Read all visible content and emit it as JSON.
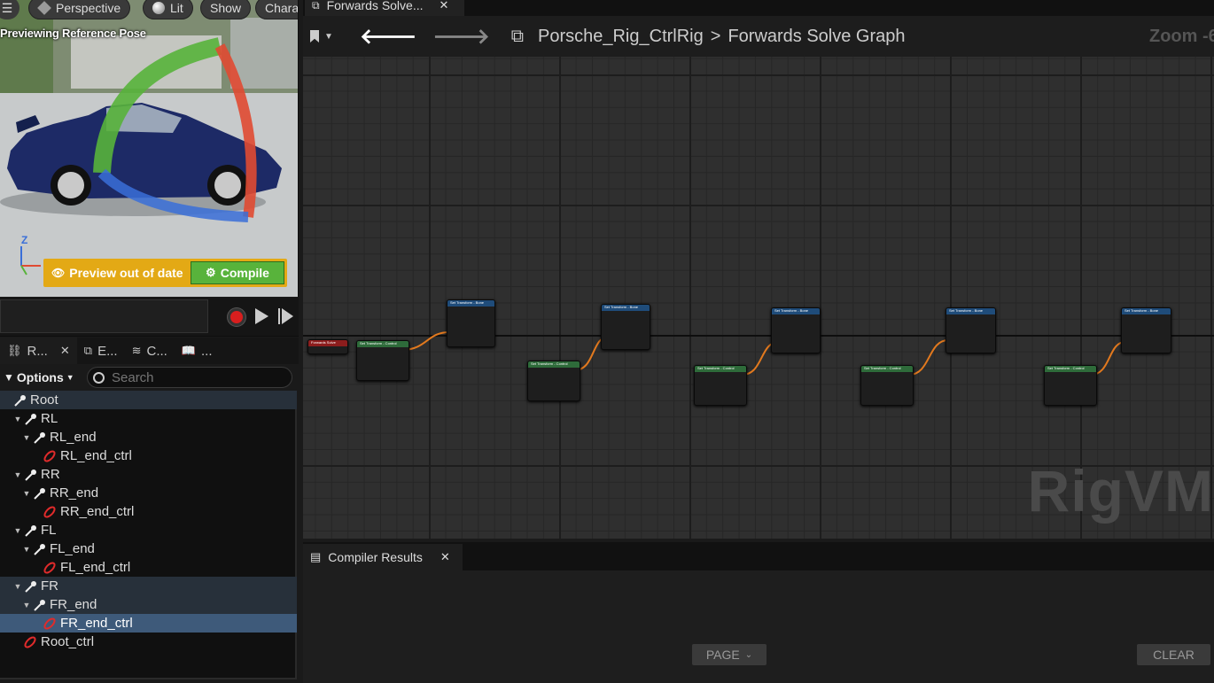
{
  "viewport": {
    "menu_icon": "hamburger-icon",
    "buttons": [
      {
        "label": "Perspective",
        "icon": "cube-icon"
      },
      {
        "label": "Lit",
        "icon": "lit-sphere-icon"
      },
      {
        "label": "Show",
        "icon": ""
      },
      {
        "label": "Chara",
        "icon": ""
      }
    ],
    "overlay_text": "Previewing Reference Pose",
    "preview_out_of_date": "Preview out of date",
    "compile": "Compile",
    "axis_label": "Z"
  },
  "transport": {
    "record_icon": "record-icon",
    "play_icon": "play-icon",
    "step_icon": "step-forward-icon"
  },
  "panel_tabs": [
    {
      "label": "R...",
      "icon": "rig-hierarchy-icon",
      "closable": true
    },
    {
      "label": "E...",
      "icon": "execution-stack-icon",
      "closable": false
    },
    {
      "label": "C...",
      "icon": "curve-container-icon",
      "closable": false
    },
    {
      "label": "...",
      "icon": "book-icon",
      "closable": false
    }
  ],
  "outliner": {
    "options": "Options",
    "search_placeholder": "Search",
    "tree": [
      {
        "label": "Root",
        "depth": 0,
        "type": "bone",
        "state": "hl"
      },
      {
        "label": "RL",
        "depth": 1,
        "type": "bone",
        "state": ""
      },
      {
        "label": "RL_end",
        "depth": 2,
        "type": "bone",
        "state": ""
      },
      {
        "label": "RL_end_ctrl",
        "depth": 3,
        "type": "control",
        "state": ""
      },
      {
        "label": "RR",
        "depth": 1,
        "type": "bone",
        "state": ""
      },
      {
        "label": "RR_end",
        "depth": 2,
        "type": "bone",
        "state": ""
      },
      {
        "label": "RR_end_ctrl",
        "depth": 3,
        "type": "control",
        "state": ""
      },
      {
        "label": "FL",
        "depth": 1,
        "type": "bone",
        "state": ""
      },
      {
        "label": "FL_end",
        "depth": 2,
        "type": "bone",
        "state": ""
      },
      {
        "label": "FL_end_ctrl",
        "depth": 3,
        "type": "control",
        "state": ""
      },
      {
        "label": "FR",
        "depth": 1,
        "type": "bone",
        "state": "hl"
      },
      {
        "label": "FR_end",
        "depth": 2,
        "type": "bone",
        "state": "hl"
      },
      {
        "label": "FR_end_ctrl",
        "depth": 3,
        "type": "control",
        "state": "sel"
      },
      {
        "label": "Root_ctrl",
        "depth": 1,
        "type": "control",
        "state": ""
      }
    ]
  },
  "graph": {
    "tab_label": "Forwards Solve...",
    "tab_icon": "graph-icon",
    "breadcrumb_root": "Porsche_Rig_CtrlRig",
    "breadcrumb_separator": ">",
    "breadcrumb_current": "Forwards Solve Graph",
    "zoom_label": "Zoom -6",
    "watermark": "RigVM",
    "entry_node": "Forwards Solve",
    "control_node_title": "Set Transform - Control",
    "bone_node_title": "Set Transform - Bone"
  },
  "results": {
    "tab_label": "Compiler Results",
    "page_label": "PAGE",
    "clear_label": "CLEAR"
  }
}
